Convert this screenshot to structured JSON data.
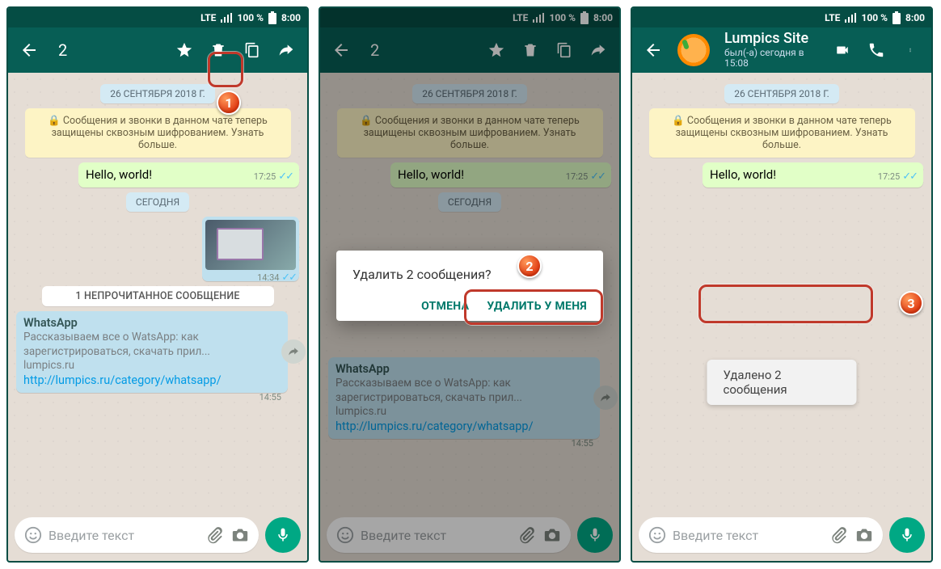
{
  "status": {
    "lte": "LTE",
    "signal": "100 %",
    "time": "8:00"
  },
  "selection": {
    "count": "2"
  },
  "contact": {
    "name": "Lumpics Site",
    "sub": "был(-а) сегодня в 15:08"
  },
  "chips": {
    "date": "26 СЕНТЯБРЯ 2018 Г.",
    "today": "СЕГОДНЯ",
    "unread": "1 НЕПРОЧИТАННОЕ СООБЩЕНИЕ"
  },
  "encryption": "🔒 Сообщения и звонки в данном чате теперь защищены сквозным шифрованием. Узнать больше.",
  "messages": {
    "hello": {
      "text": "Hello, world!",
      "time": "17:25"
    },
    "image": {
      "time": "14:34"
    },
    "incoming": {
      "title": "WhatsApp",
      "desc": "Рассказываем все о WatsApp: как зарегистрироваться, скачать прил...",
      "domain": "lumpics.ru",
      "link": "http://lumpics.ru/category/whatsapp/",
      "time": "14:55"
    }
  },
  "input": {
    "placeholder": "Введите текст"
  },
  "dialog": {
    "title": "Удалить 2 сообщения?",
    "cancel": "ОТМЕНА",
    "confirm": "УДАЛИТЬ У МЕНЯ"
  },
  "toast": "Удалено 2 сообщения",
  "markers": {
    "m1": "1",
    "m2": "2",
    "m3": "3"
  }
}
